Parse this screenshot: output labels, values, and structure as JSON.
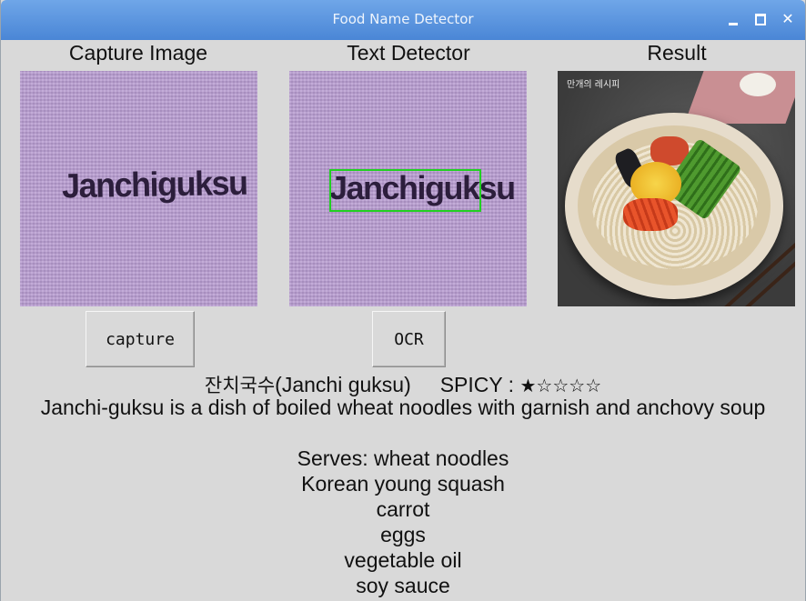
{
  "window": {
    "title": "Food Name Detector",
    "controls": {
      "minimize_icon": "minimize-icon",
      "maximize_icon": "maximize-icon",
      "close_icon": "close-icon",
      "close_label": "✕"
    }
  },
  "panels": {
    "capture": {
      "heading": "Capture Image",
      "word": "Janchiguksu"
    },
    "detector": {
      "heading": "Text Detector",
      "word": "Janchiguksu",
      "box_color": "#22d022"
    },
    "result": {
      "heading": "Result",
      "logo": "만개의 레시피"
    }
  },
  "buttons": {
    "capture": "capture",
    "ocr": "OCR"
  },
  "result_info": {
    "korean_name": "잔치국수",
    "roman_name": "(Janchi guksu)",
    "spicy_label": "SPICY :",
    "spicy_stars": "★☆☆☆☆",
    "description": "Janchi-guksu is a dish of boiled wheat noodles with garnish and anchovy soup",
    "serves_label": "Serves: ",
    "ingredients": [
      "wheat noodles",
      "Korean young squash",
      "carrot",
      "eggs",
      "vegetable oil",
      "soy sauce"
    ]
  },
  "colors": {
    "titlebar": "#4a86d6",
    "window_bg": "#d9d9d9",
    "screen_purple": "#b79bd0"
  }
}
